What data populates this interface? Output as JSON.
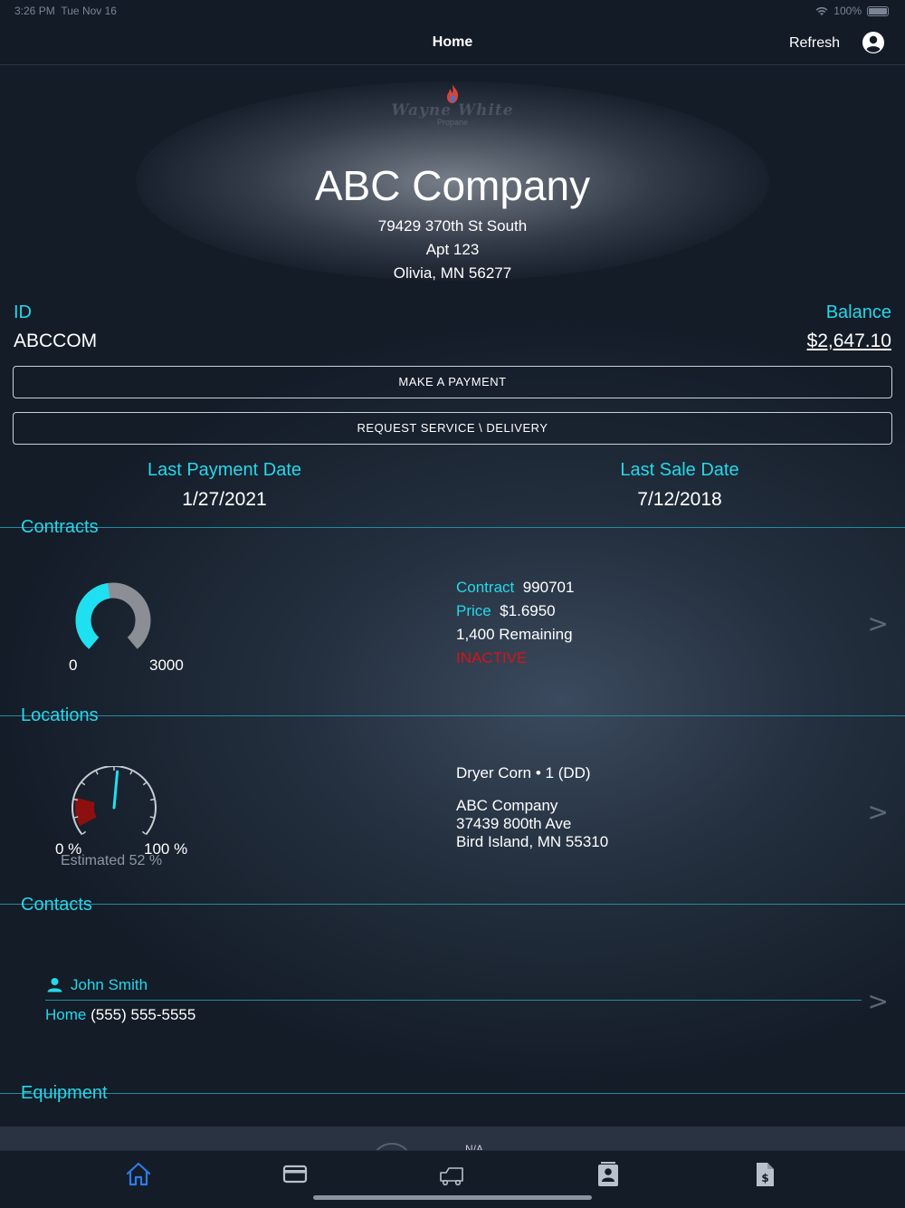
{
  "status": {
    "time": "3:26 PM",
    "date": "Tue Nov 16",
    "battery": "100%"
  },
  "nav": {
    "title": "Home",
    "refresh_label": "Refresh"
  },
  "logo": {
    "text": "Wayne White",
    "sub": "Propane"
  },
  "customer": {
    "name": "ABC Company",
    "address_line1": "79429 370th St South",
    "address_line2": "Apt 123",
    "address_line3": "Olivia, MN 56277",
    "id_label": "ID",
    "id": "ABCCOM",
    "balance_label": "Balance",
    "balance": "$2,647.10"
  },
  "buttons": {
    "make_payment": "MAKE A PAYMENT",
    "request_service": "REQUEST SERVICE \\ DELIVERY"
  },
  "dates": {
    "last_payment_label": "Last Payment Date",
    "last_payment": "1/27/2021",
    "last_sale_label": "Last Sale Date",
    "last_sale": "7/12/2018"
  },
  "sections": {
    "contracts": "Contracts",
    "locations": "Locations",
    "contacts": "Contacts",
    "equipment": "Equipment"
  },
  "contract": {
    "gauge_min": "0",
    "gauge_max": "3000",
    "gauge_fill_fraction": 0.47,
    "contract_label": "Contract",
    "contract_number": "990701",
    "price_label": "Price",
    "price": "$1.6950",
    "remaining": "1,400 Remaining",
    "status": "INACTIVE",
    "chevron": ">"
  },
  "location": {
    "gauge_min": "0 %",
    "gauge_max": "100 %",
    "estimated": "Estimated 52 %",
    "estimated_percent": 52,
    "tank": "Dryer Corn • 1 (DD)",
    "name": "ABC Company",
    "street": "37439 800th Ave",
    "city": "Bird Island, MN  55310",
    "chevron": ">"
  },
  "contact": {
    "name": "John Smith",
    "phone_label": "Home",
    "phone": "(555) 555-5555",
    "chevron": ">"
  },
  "equipment": {
    "value": "N/A"
  },
  "tabs": [
    {
      "icon": "home-icon",
      "active": true
    },
    {
      "icon": "credit-card-icon",
      "active": false
    },
    {
      "icon": "delivery-truck-icon",
      "active": false
    },
    {
      "icon": "contact-book-icon",
      "active": false
    },
    {
      "icon": "invoice-dollar-icon",
      "active": false
    }
  ],
  "colors": {
    "accent": "#25d8ea",
    "danger": "#d41418",
    "tab_active": "#2f7be6",
    "tab_inactive": "#b9c1cb"
  }
}
